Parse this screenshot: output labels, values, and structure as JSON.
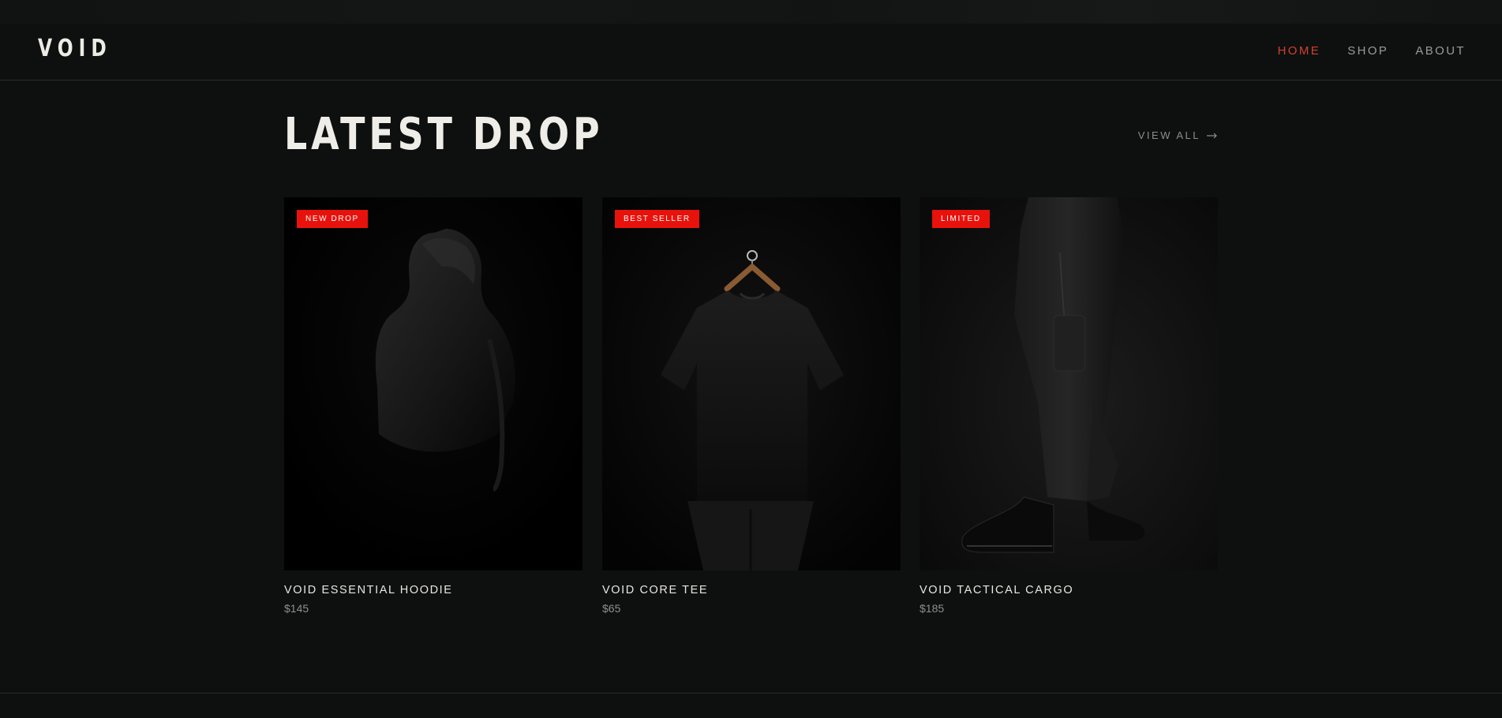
{
  "brand": {
    "logo": "VOID"
  },
  "nav": {
    "items": [
      {
        "label": "HOME",
        "active": true
      },
      {
        "label": "SHOP",
        "active": false
      },
      {
        "label": "ABOUT",
        "active": false
      }
    ]
  },
  "section": {
    "title": "LATEST DROP",
    "view_all_label": "VIEW ALL",
    "view_all_icon": "arrow-right-icon"
  },
  "products": [
    {
      "badge": "NEW DROP",
      "name": "VOID ESSENTIAL HOODIE",
      "price": "$145",
      "image": "hooded-figure-photo"
    },
    {
      "badge": "BEST SELLER",
      "name": "VOID CORE TEE",
      "price": "$65",
      "image": "black-tee-on-hanger-photo"
    },
    {
      "badge": "LIMITED",
      "name": "VOID TACTICAL CARGO",
      "price": "$185",
      "image": "cargo-pants-boots-photo"
    }
  ],
  "colors": {
    "background": "#0e1010",
    "accent": "#d2402f",
    "badge": "#e8120c",
    "text": "#efede7",
    "muted": "#8e8e8c"
  }
}
